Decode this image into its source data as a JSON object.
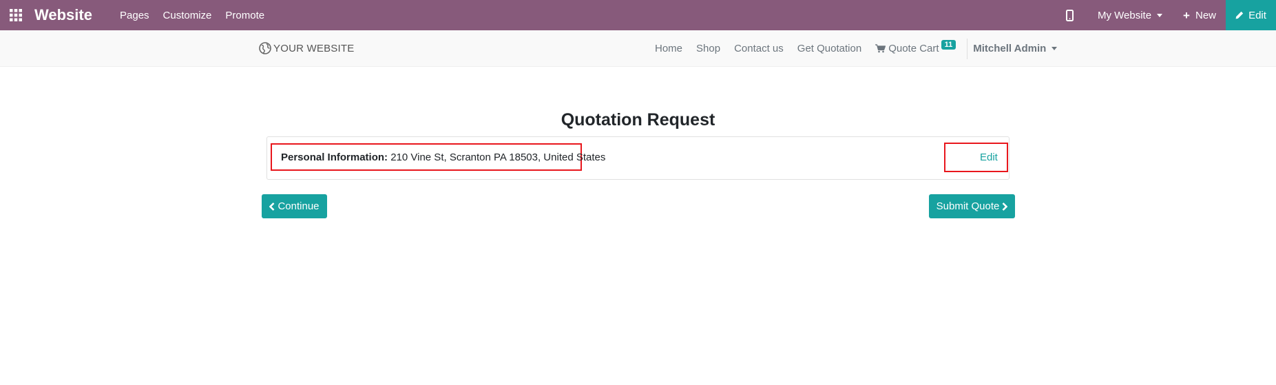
{
  "admin_bar": {
    "app_icon": "apps-grid-icon",
    "brand": "Website",
    "menu": [
      "Pages",
      "Customize",
      "Promote"
    ],
    "mobile_icon": "mobile-phone-icon",
    "site_selector": "My Website",
    "new_label": "New",
    "edit_label": "Edit",
    "bg_color": "#875a7b",
    "edit_bg_color": "#17a2a0"
  },
  "site_header": {
    "logo_icon": "globe-icon",
    "logo_text": "YOUR WEBSITE",
    "nav": [
      "Home",
      "Shop",
      "Contact us",
      "Get Quotation"
    ],
    "cart_icon": "shopping-cart-icon",
    "quote_cart_label": "Quote Cart",
    "quote_cart_count": "11",
    "user_name": "Mitchell Admin"
  },
  "main": {
    "title": "Quotation Request",
    "personal_info_label": "Personal Information:",
    "personal_info_value": " 210 Vine St, Scranton PA 18503, United States",
    "edit_link": "Edit",
    "continue_button": "Continue",
    "submit_button": "Submit Quote",
    "highlight_color": "#e8161c",
    "accent_color": "#17a2a0"
  }
}
